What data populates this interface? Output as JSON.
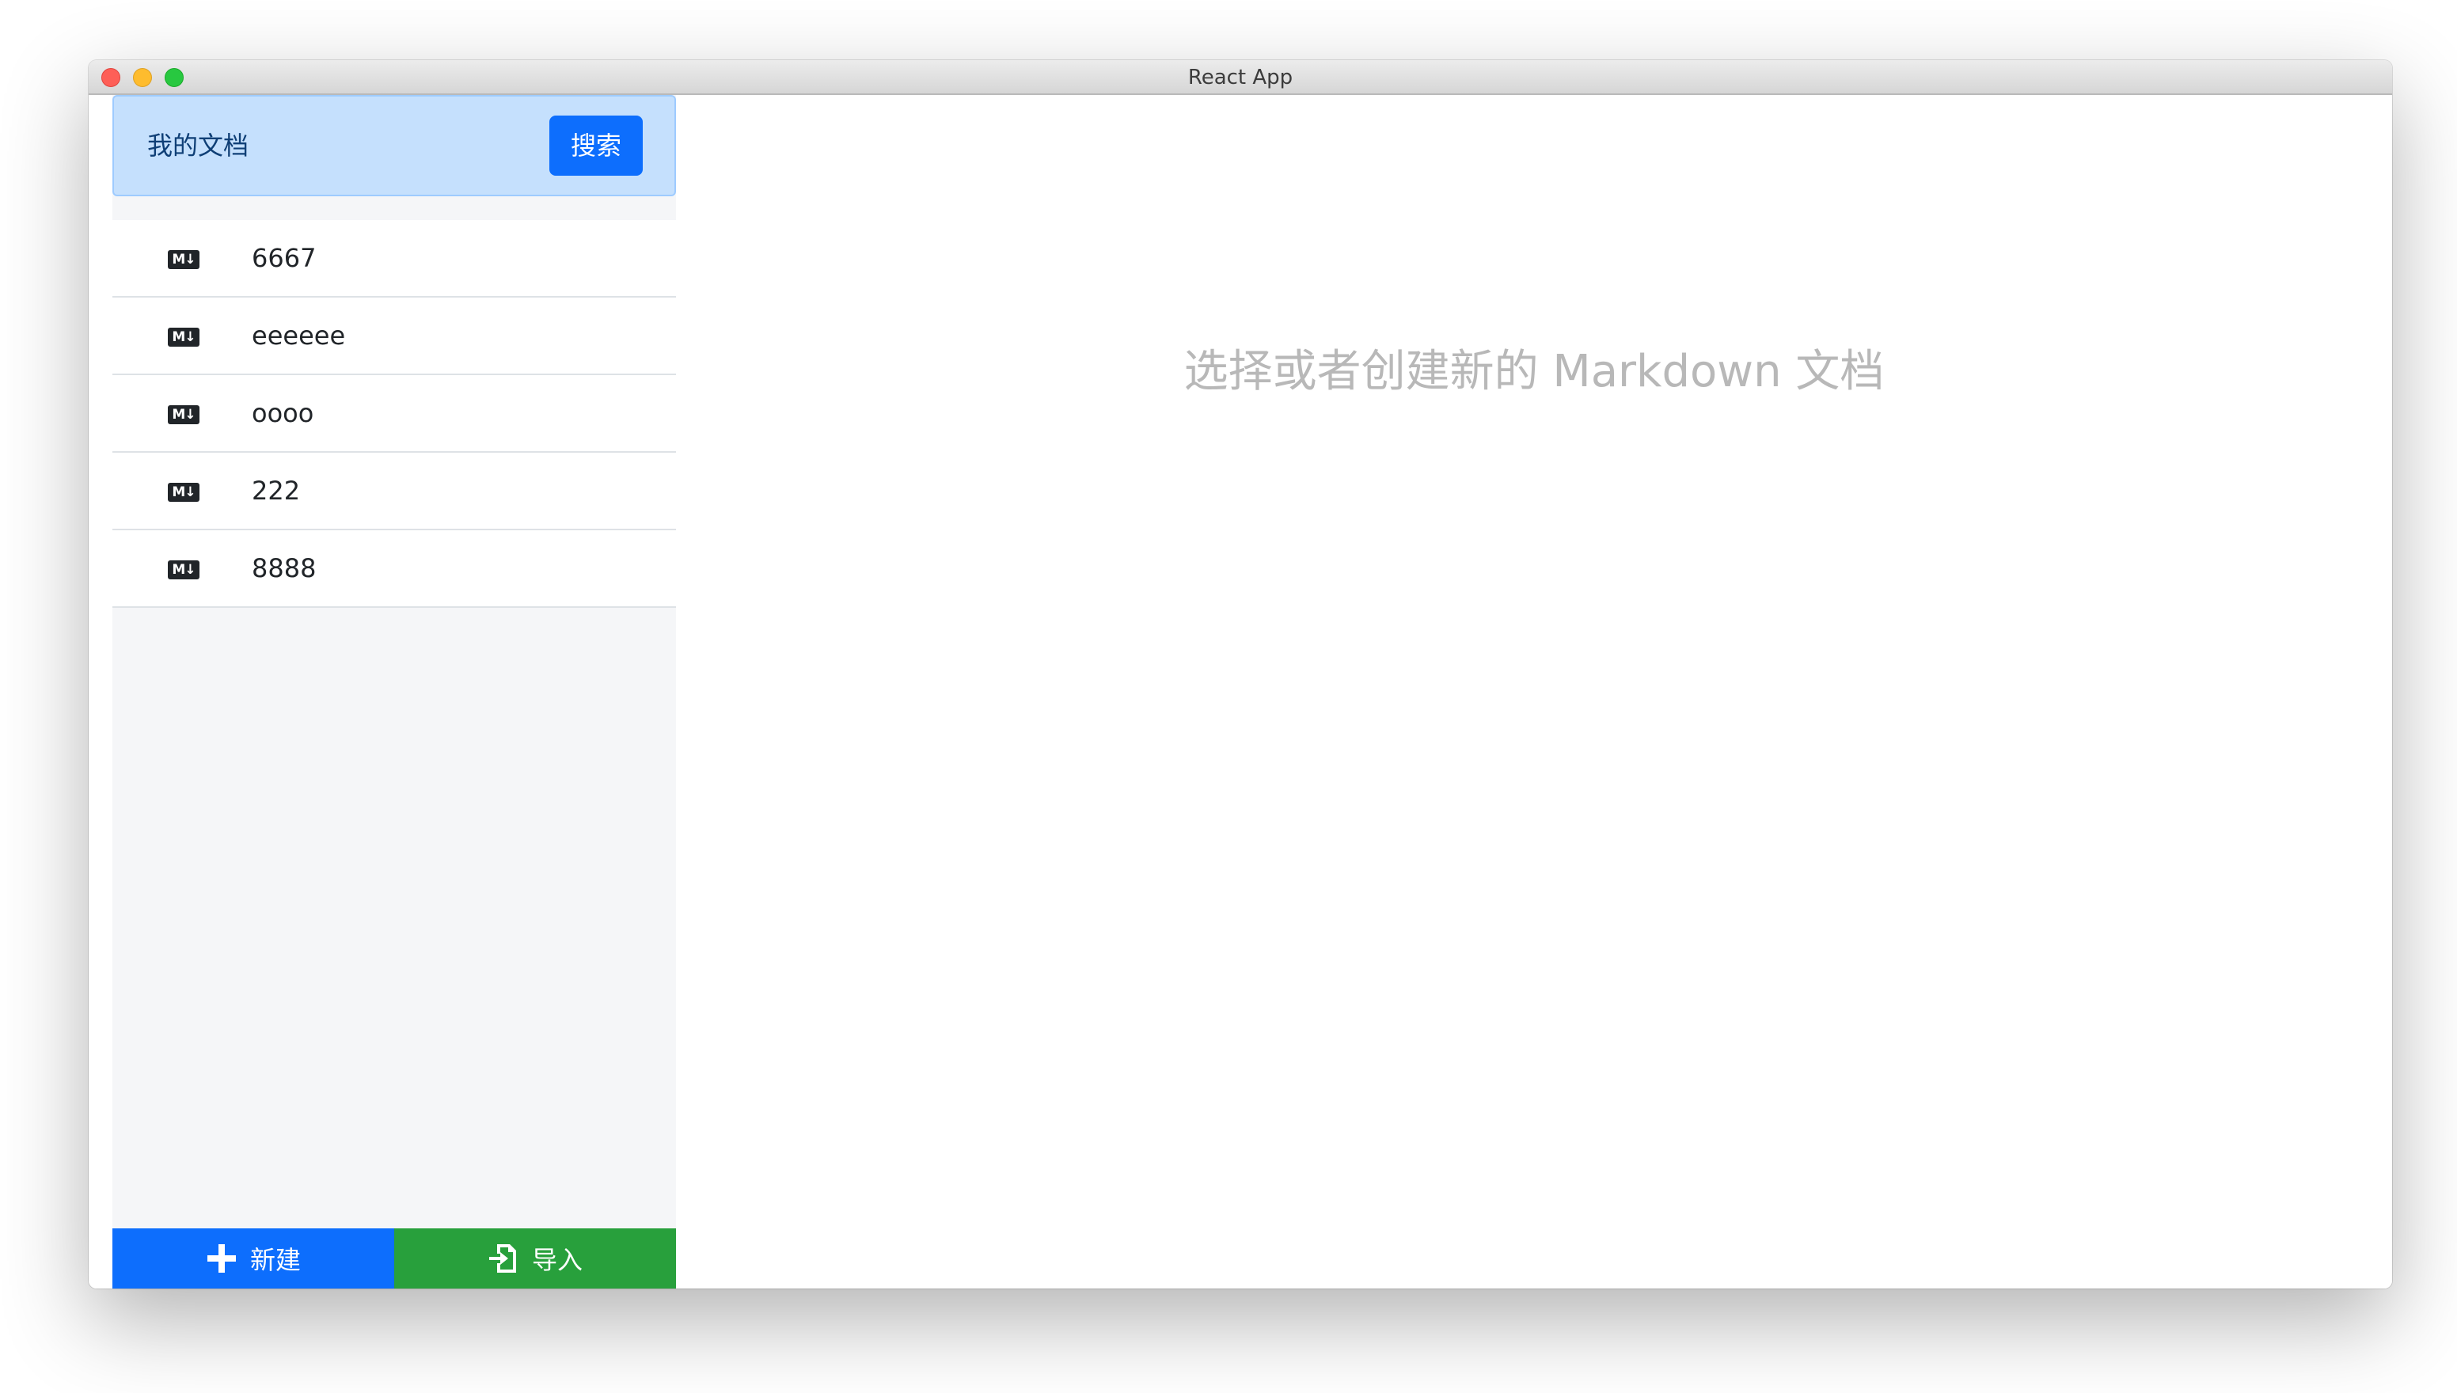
{
  "window": {
    "title": "React App"
  },
  "sidebar": {
    "title": "我的文档",
    "search_label": "搜索",
    "files": [
      {
        "name": "6667",
        "icon": "markdown-icon"
      },
      {
        "name": "eeeeee",
        "icon": "markdown-icon"
      },
      {
        "name": "oooo",
        "icon": "markdown-icon"
      },
      {
        "name": "222",
        "icon": "markdown-icon"
      },
      {
        "name": "8888",
        "icon": "markdown-icon"
      }
    ],
    "md_badge": "M↓",
    "new_label": "新建",
    "import_label": "导入"
  },
  "main": {
    "placeholder": "选择或者创建新的 Markdown 文档"
  },
  "colors": {
    "primary": "#0d6efd",
    "success": "#28a03c",
    "header_bg": "#c5e0fd",
    "sidebar_bg": "#f5f6f8",
    "placeholder_text": "#b8b8b8"
  }
}
